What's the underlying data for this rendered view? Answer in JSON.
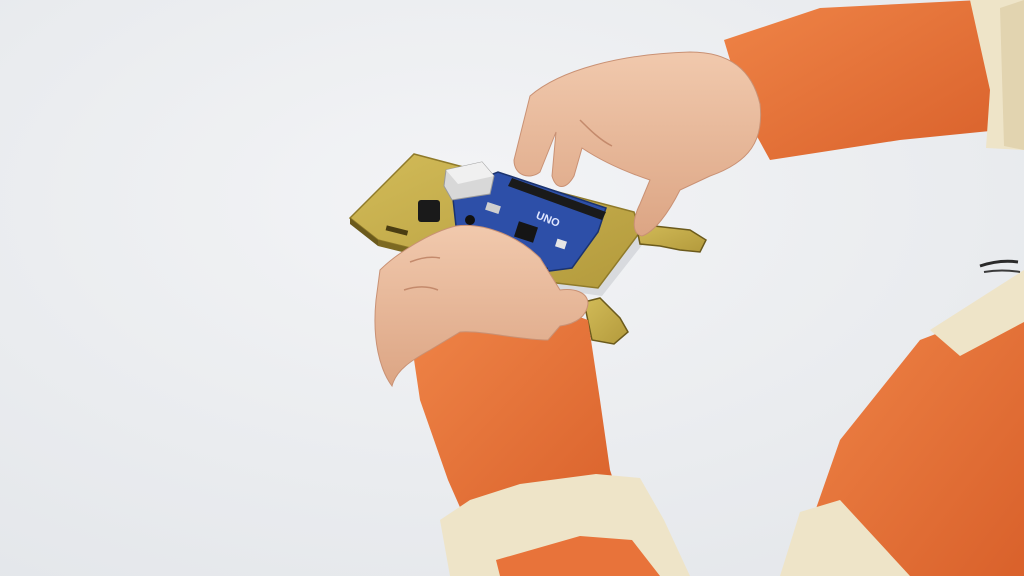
{
  "scene": {
    "description_alt": "",
    "board": {
      "label": "UNO",
      "board_color": "#2d4fa8",
      "base_color": "#c6ad4a"
    },
    "colors": {
      "background": "#e9ebee",
      "sleeve_orange": "#e8733a",
      "cuff_cream": "#eee4c8",
      "skin": "#e7b99c"
    }
  }
}
